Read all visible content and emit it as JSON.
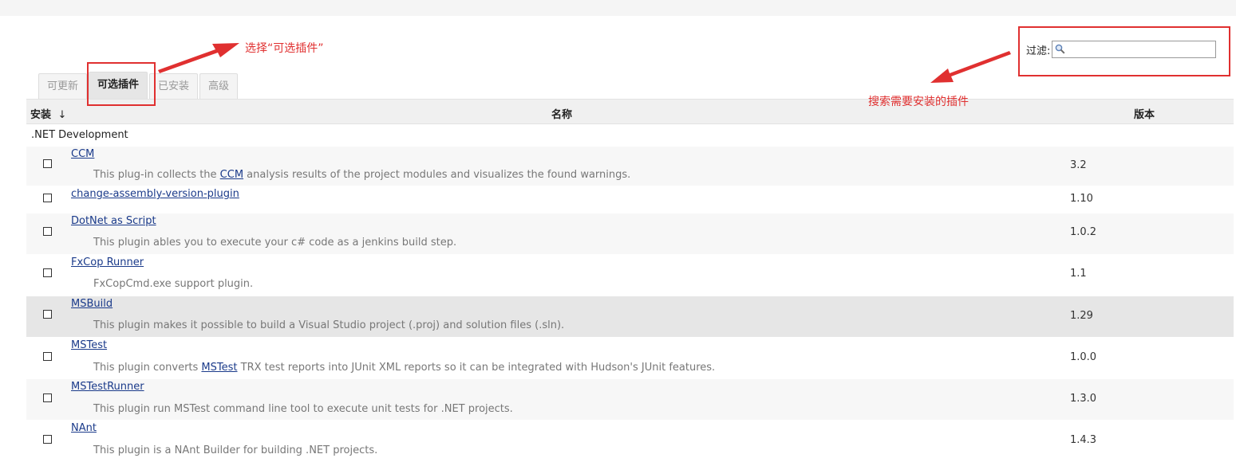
{
  "filter": {
    "label": "过滤:",
    "value": ""
  },
  "tabs": [
    {
      "label": "可更新",
      "active": false
    },
    {
      "label": "可选插件",
      "active": true
    },
    {
      "label": "已安装",
      "active": false
    },
    {
      "label": "高级",
      "active": false
    }
  ],
  "table": {
    "headers": {
      "install": "安装",
      "sort_arrow": "↓",
      "name": "名称",
      "version": "版本"
    },
    "category": ".NET Development",
    "rows": [
      {
        "name": "CCM",
        "desc_pre": "This plug-in collects the ",
        "desc_link": "CCM",
        "desc_post": " analysis results of the project modules and visualizes the found warnings.",
        "version": "3.2"
      },
      {
        "name": "change-assembly-version-plugin",
        "desc_pre": "",
        "desc_link": "",
        "desc_post": "",
        "version": "1.10"
      },
      {
        "name": "DotNet as Script",
        "desc_pre": "This plugin ables you to execute your c# code as a jenkins build step.",
        "desc_link": "",
        "desc_post": "",
        "version": "1.0.2"
      },
      {
        "name": "FxCop Runner",
        "desc_pre": "FxCopCmd.exe support plugin.",
        "desc_link": "",
        "desc_post": "",
        "version": "1.1"
      },
      {
        "name": "MSBuild",
        "desc_pre": "This plugin makes it possible to build a Visual Studio project (.proj) and solution files (.sln).",
        "desc_link": "",
        "desc_post": "",
        "version": "1.29"
      },
      {
        "name": "MSTest",
        "desc_pre": "This plugin converts ",
        "desc_link": "MSTest",
        "desc_post": " TRX test reports into JUnit XML reports so it can be integrated with Hudson's JUnit features.",
        "version": "1.0.0"
      },
      {
        "name": "MSTestRunner",
        "desc_pre": "This plugin run MSTest command line tool to execute unit tests for .NET projects.",
        "desc_link": "",
        "desc_post": "",
        "version": "1.3.0"
      },
      {
        "name": "NAnt",
        "desc_pre": "This plugin is a NAnt Builder for building .NET projects.",
        "desc_link": "",
        "desc_post": "",
        "version": "1.4.3"
      }
    ]
  },
  "annotations": {
    "select_tab_note": "选择“可选插件”",
    "search_note": "搜索需要安装的插件",
    "color": "#e03030"
  },
  "icons": {
    "filter": "search-icon"
  }
}
